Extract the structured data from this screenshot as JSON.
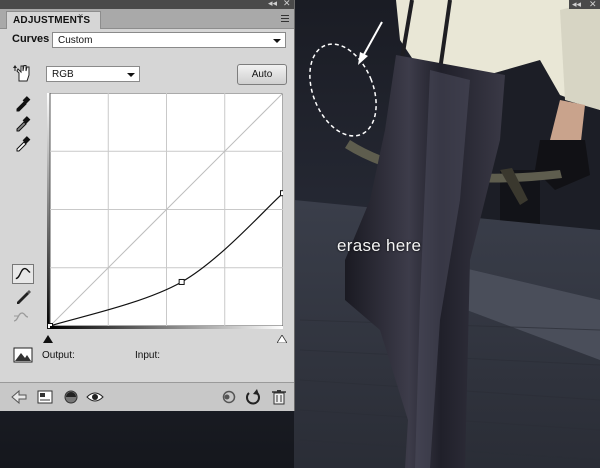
{
  "panel": {
    "tab_label": "ADJUSTMENTS",
    "tab_close_glyph": "×",
    "top_collapse_glyph": "◂◂",
    "top_close_glyph": "✕",
    "curves_label": "Curves",
    "preset_value": "Custom",
    "channel_value": "RGB",
    "auto_label": "Auto",
    "output_label": "Output:",
    "input_label": "Input:",
    "curve_points": [
      [
        0,
        0
      ],
      [
        0.565,
        0.189
      ],
      [
        1,
        0.57
      ]
    ],
    "icons": {
      "hand": "on-image-adjust-icon",
      "eyedropper_black": "eyedropper-black-icon",
      "eyedropper_gray": "eyedropper-gray-icon",
      "eyedropper_white": "eyedropper-white-icon",
      "curve_tool": "edit-points-curve-icon",
      "pencil_tool": "draw-pencil-icon",
      "smooth_tool": "smooth-curve-icon",
      "clipping": "show-clipping-icon",
      "back": "back-arrow-icon",
      "expanded_view": "expanded-view-icon",
      "clip_to_layer": "clip-to-layer-icon",
      "visibility": "eye-icon",
      "previous_state": "previous-state-icon",
      "reset": "reset-icon",
      "delete": "trash-icon"
    }
  },
  "annotation": {
    "text": "erase here"
  },
  "window_controls": {
    "collapse_glyph": "◂◂",
    "close_glyph": "✕"
  }
}
